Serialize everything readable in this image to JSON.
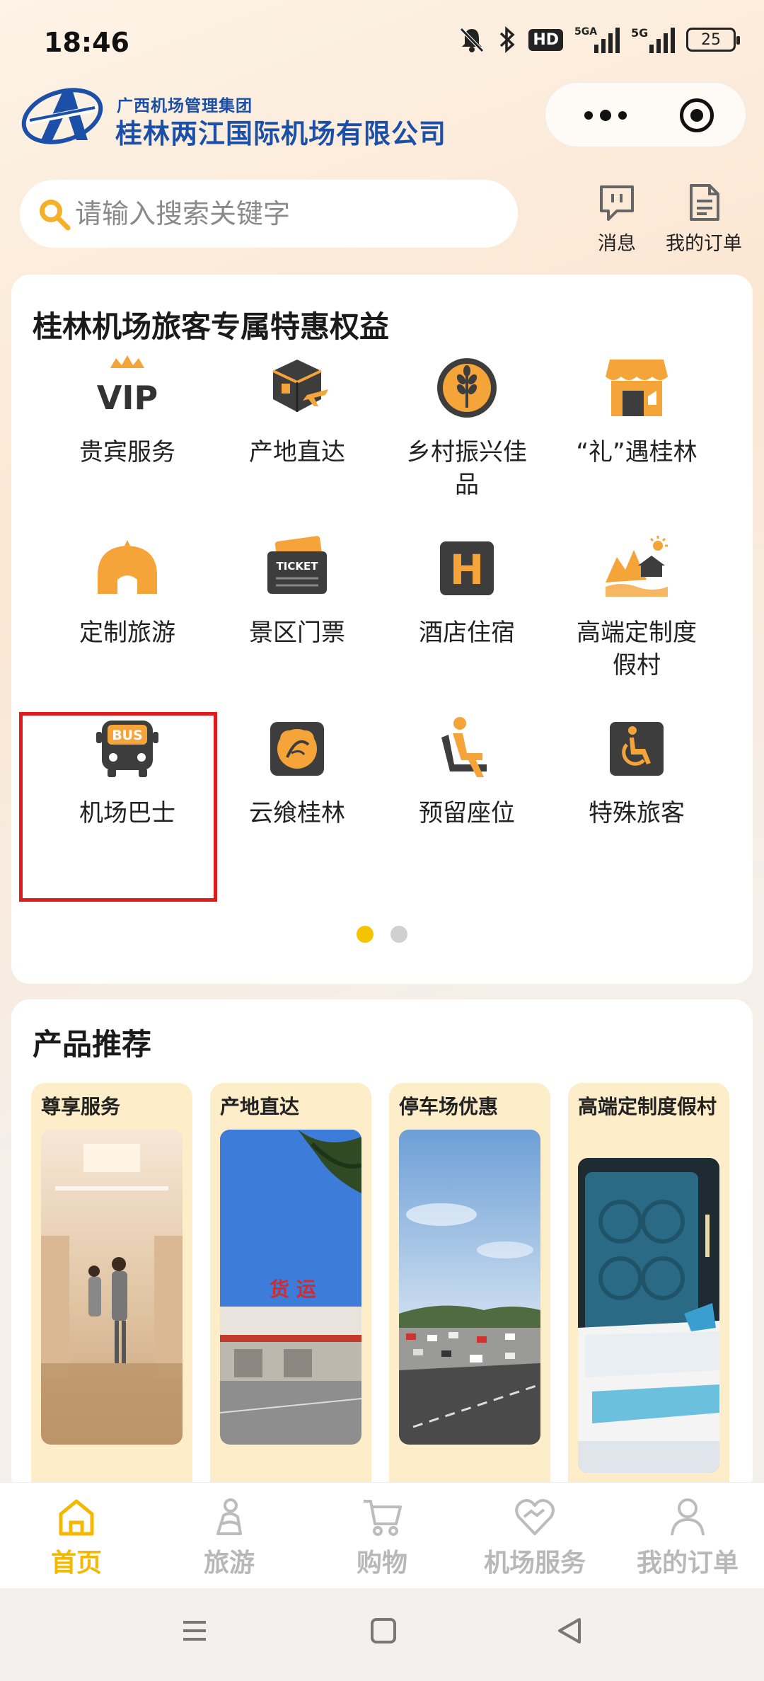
{
  "status_bar": {
    "time": "18:46",
    "hd_label": "HD",
    "sim1_label": "5GA",
    "sim2_label": "5G",
    "battery": "25"
  },
  "header": {
    "brand_sub": "广西机场管理集团",
    "brand_main": "桂林两江国际机场有限公司",
    "logo_icon": "airport-logo"
  },
  "search": {
    "placeholder": "请输入搜索关键字"
  },
  "top_actions": [
    {
      "label": "消息",
      "icon": "message-icon"
    },
    {
      "label": "我的订单",
      "icon": "order-icon"
    }
  ],
  "benefits": {
    "title": "桂林机场旅客专属特惠权益",
    "items": [
      {
        "label": "贵宾服务",
        "icon": "vip-icon"
      },
      {
        "label": "产地直达",
        "icon": "parcel-icon"
      },
      {
        "label": "乡村振兴佳品",
        "icon": "wheat-icon"
      },
      {
        "label": "“礼”遇桂林",
        "icon": "shop-icon"
      },
      {
        "label": "定制旅游",
        "icon": "yurt-icon"
      },
      {
        "label": "景区门票",
        "icon": "ticket-icon"
      },
      {
        "label": "酒店住宿",
        "icon": "hotel-icon"
      },
      {
        "label": "高端定制度假村",
        "icon": "resort-icon"
      },
      {
        "label": "机场巴士",
        "icon": "bus-icon"
      },
      {
        "label": "云飨桂林",
        "icon": "food-icon"
      },
      {
        "label": "预留座位",
        "icon": "seat-icon"
      },
      {
        "label": "特殊旅客",
        "icon": "accessible-icon"
      }
    ],
    "ticket_text": "TICKET",
    "bus_text": "BUS",
    "hotel_text": "H",
    "vip_text": "VIP",
    "page_count": 2,
    "active_page": 1
  },
  "products": {
    "title": "产品推荐",
    "items": [
      {
        "title": "尊享服务"
      },
      {
        "title": "产地直达"
      },
      {
        "title": "停车场优惠"
      },
      {
        "title": "高端定制度假村"
      }
    ],
    "freight_sign": "货 运"
  },
  "tabbar": {
    "tabs": [
      {
        "label": "首页",
        "icon": "home-icon",
        "active": true
      },
      {
        "label": "旅游",
        "icon": "travel-icon",
        "active": false
      },
      {
        "label": "购物",
        "icon": "cart-icon",
        "active": false
      },
      {
        "label": "机场服务",
        "icon": "service-icon",
        "active": false
      },
      {
        "label": "我的订单",
        "icon": "user-icon",
        "active": false
      }
    ]
  },
  "colors": {
    "accent": "#f5b800",
    "brand_blue": "#1b4fa8",
    "highlight_red": "#e01b1b",
    "icon_orange": "#f5a43a",
    "icon_dark": "#3d3d3d"
  }
}
